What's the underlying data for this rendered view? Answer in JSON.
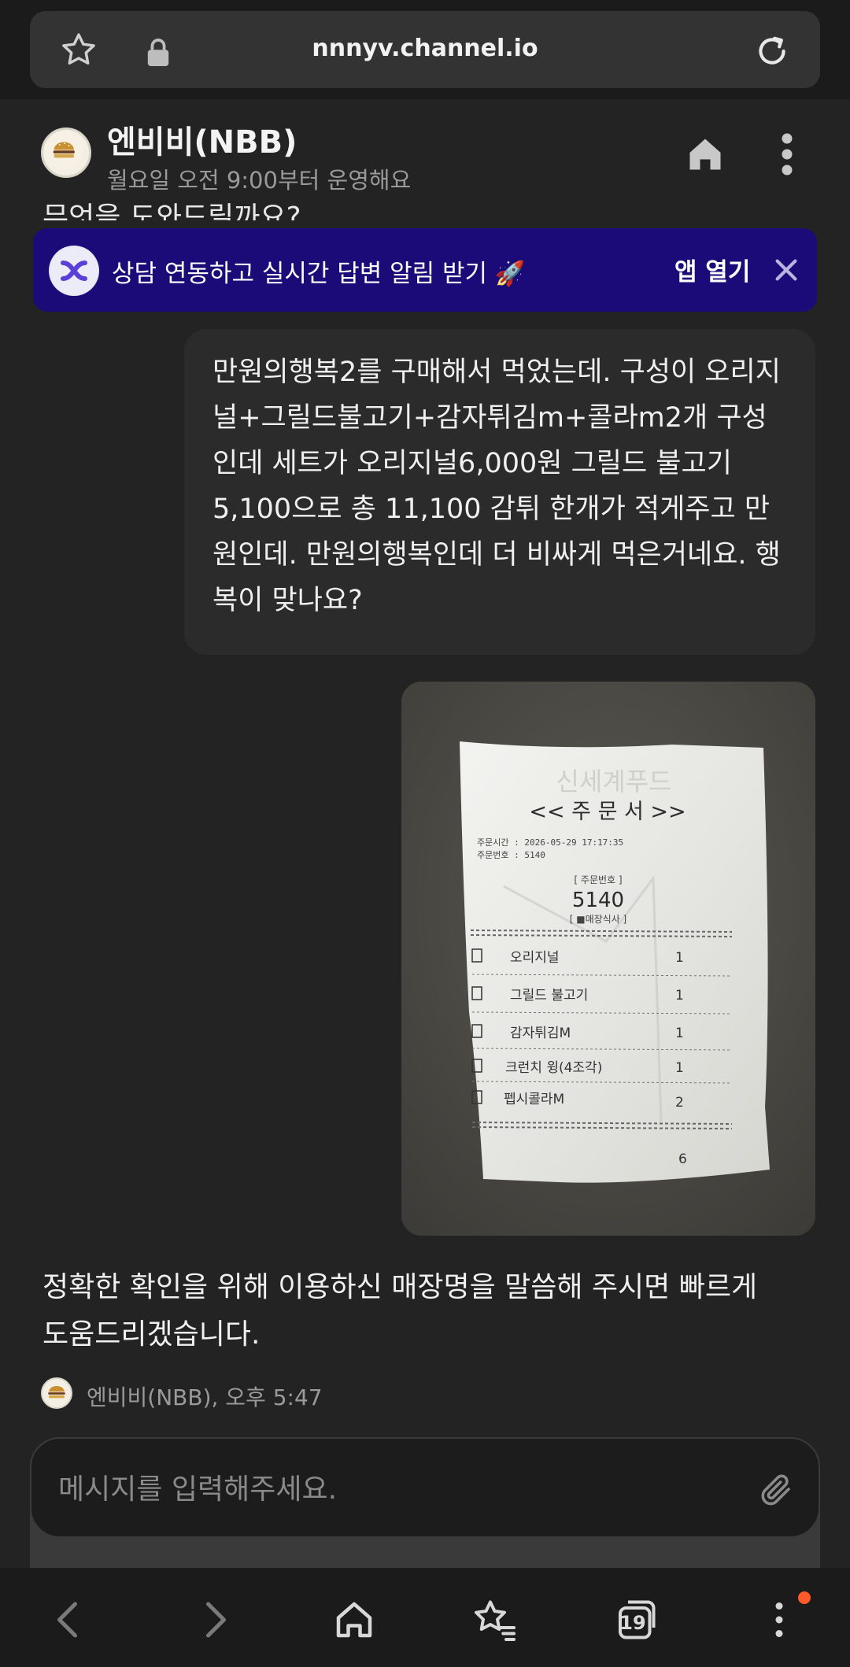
{
  "browser": {
    "url": "nnnyv.channel.io",
    "tab_count": "19"
  },
  "channel": {
    "name": "엔비비(NBB)",
    "hours": "월요일 오전 9:00부터 운영해요",
    "peek_text": "무엇을 도와드릴까요?"
  },
  "banner": {
    "text": "상담 연동하고 실시간 답변 알림 받기 🚀",
    "open_label": "앱 열기"
  },
  "messages": {
    "user_text": "만원의행복2를 구매해서 먹었는데. 구성이 오리지널+그릴드불고기+감자튀김m+콜라m2개 구성인데 세트가 오리지널6,000원 그릴드 불고기 5,100으로 총 11,100 감튀 한개가 적게주고 만원인데. 만원의행복인데 더 비싸게 먹은거네요. 행복이 맞나요?",
    "bot_text": "정확한 확인을 위해 이용하신 매장명을 말씀해 주시면 빠르게 도움드리겠습니다.",
    "bot_meta": "엔비비(NBB), 오후 5:47"
  },
  "receipt": {
    "watermark": "신세계푸드",
    "title": "<< 주 문 서 >>",
    "order_time": "주문시간 : 2026-05-29 17:17:35",
    "order_no_line": "주문번호 : 5140",
    "order_no_label": "[ 주문번호 ]",
    "order_no": "5140",
    "dine_type": "[ ■매장식사 ]",
    "items": [
      {
        "name": "오리지널",
        "qty": "1"
      },
      {
        "name": "그릴드 불고기",
        "qty": "1"
      },
      {
        "name": "감자튀김M",
        "qty": "1"
      },
      {
        "name": "크런치 윙(4조각)",
        "qty": "1"
      },
      {
        "name": "펩시콜라M",
        "qty": "2"
      }
    ],
    "total_qty": "6"
  },
  "composer": {
    "placeholder": "메시지를 입력해주세요."
  },
  "colors": {
    "background": "#232323",
    "banner": "#1a0b78",
    "bubble": "#2b2b2b",
    "notif_dot": "#ff5a2a"
  }
}
